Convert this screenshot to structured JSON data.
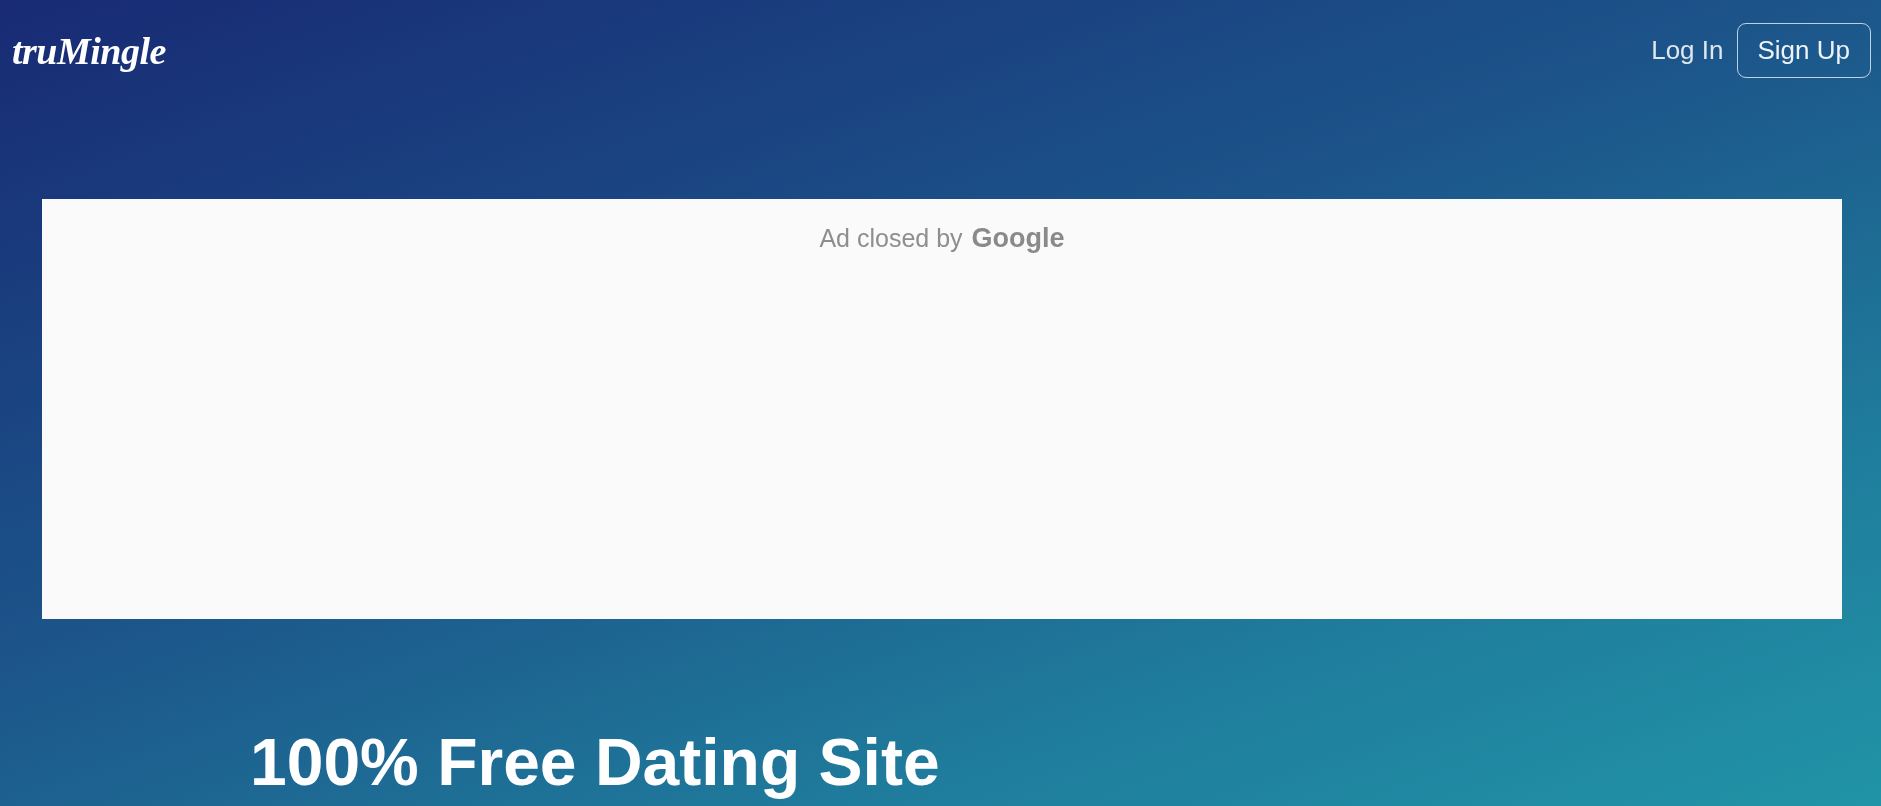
{
  "header": {
    "logo": "truMingle",
    "nav": [
      {
        "label": "Log In",
        "kind": "link"
      },
      {
        "label": "Sign Up",
        "kind": "outline"
      }
    ]
  },
  "ad_slot": {
    "notice": "Ad closed by",
    "brand": "Google"
  },
  "hero": {
    "heading": "100% Free Dating Site"
  }
}
